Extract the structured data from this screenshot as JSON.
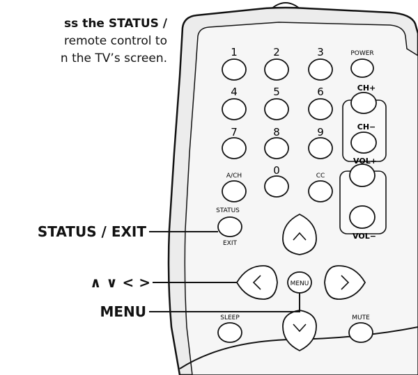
{
  "instruction": {
    "line1_bold": "ss the STATUS /",
    "line2": "remote control to",
    "line3": "n the TV’s screen."
  },
  "callouts": {
    "status_exit": "STATUS / EXIT",
    "arrows": "∧ ∨ < >",
    "menu": "MENU"
  },
  "remote": {
    "numbers": [
      "1",
      "2",
      "3",
      "4",
      "5",
      "6",
      "7",
      "8",
      "9",
      "0"
    ],
    "power": "POWER",
    "ch_plus": "CH+",
    "ch_minus": "CH−",
    "vol_plus": "VOL+",
    "vol_minus": "VOL−",
    "ach": "A/CH",
    "cc": "CC",
    "status": "STATUS",
    "exit": "EXIT",
    "menu": "MENU",
    "sleep": "SLEEP",
    "mute": "MUTE",
    "arrow_up": "∧",
    "arrow_down": "∨",
    "arrow_left": "<",
    "arrow_right": ">"
  }
}
